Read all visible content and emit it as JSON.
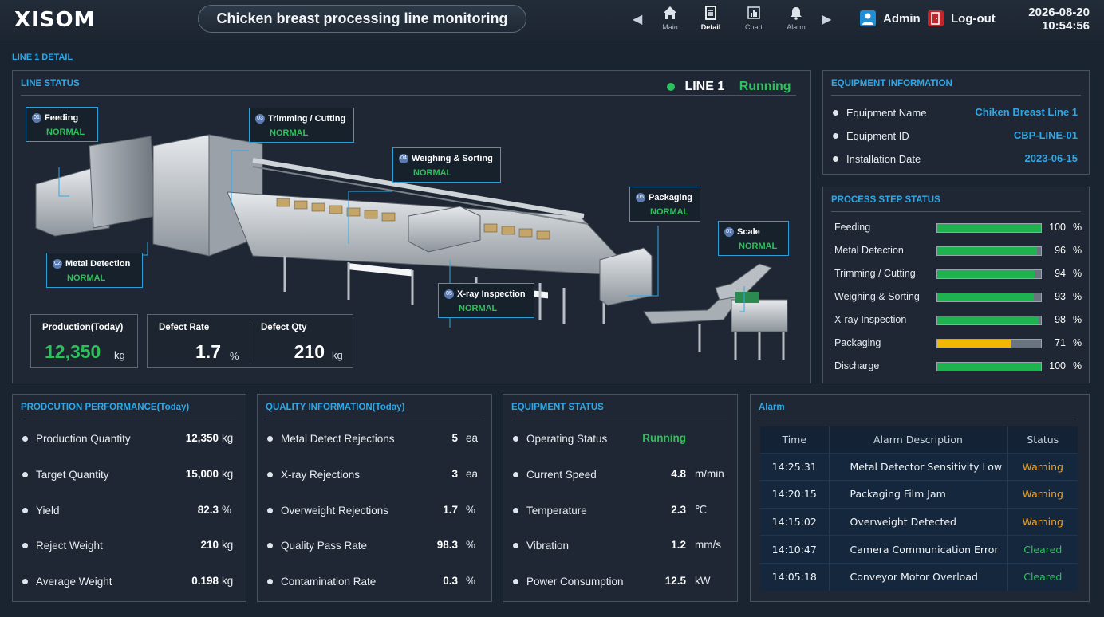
{
  "header": {
    "logo": "XISOM",
    "title": "Chicken breast processing line monitoring",
    "nav": [
      {
        "label": "Main",
        "icon": "home-icon"
      },
      {
        "label": "Detail",
        "icon": "document-icon"
      },
      {
        "label": "Chart",
        "icon": "chart-icon"
      },
      {
        "label": "Alarm",
        "icon": "bell-icon"
      }
    ],
    "user": "Admin",
    "logout": "Log-out",
    "date": "2026-08-20",
    "time": "10:54:56"
  },
  "page_label": "LINE 1 DETAIL",
  "line_status": {
    "title": "LINE STATUS",
    "line_name": "LINE 1",
    "line_state": "Running",
    "steps": [
      {
        "num": "01",
        "name": "Feeding",
        "status": "NORMAL"
      },
      {
        "num": "02",
        "name": "Metal Detection",
        "status": "NORMAL"
      },
      {
        "num": "03",
        "name": "Trimming / Cutting",
        "status": "NORMAL"
      },
      {
        "num": "04",
        "name": "Weighing & Sorting",
        "status": "NORMAL"
      },
      {
        "num": "05",
        "name": "X-ray Inspection",
        "status": "NORMAL"
      },
      {
        "num": "06",
        "name": "Packaging",
        "status": "NORMAL"
      },
      {
        "num": "07",
        "name": "Scale",
        "status": "NORMAL"
      }
    ],
    "production_label": "Production(Today)",
    "production_value": "12,350",
    "production_unit": "kg",
    "defect_rate_label": "Defect Rate",
    "defect_rate_value": "1.7",
    "defect_rate_unit": "%",
    "defect_qty_label": "Defect Qty",
    "defect_qty_value": "210",
    "defect_qty_unit": "kg"
  },
  "equipment_info": {
    "title": "EQUIPMENT INFORMATION",
    "rows": [
      {
        "label": "Equipment Name",
        "value": "Chiken Breast Line 1"
      },
      {
        "label": "Equipment ID",
        "value": "CBP-LINE-01"
      },
      {
        "label": "Installation Date",
        "value": "2023-06-15"
      }
    ]
  },
  "process_step_status": {
    "title": "PROCESS STEP STATUS",
    "unit": "%",
    "rows": [
      {
        "label": "Feeding",
        "value": 100,
        "color": "#1fb34f"
      },
      {
        "label": "Metal Detection",
        "value": 96,
        "color": "#1fb34f"
      },
      {
        "label": "Trimming / Cutting",
        "value": 94,
        "color": "#1fb34f"
      },
      {
        "label": "Weighing & Sorting",
        "value": 93,
        "color": "#1fb34f"
      },
      {
        "label": "X-ray Inspection",
        "value": 98,
        "color": "#1fb34f"
      },
      {
        "label": "Packaging",
        "value": 71,
        "color": "#f2b705"
      },
      {
        "label": "Discharge",
        "value": 100,
        "color": "#1fb34f"
      }
    ]
  },
  "production_performance": {
    "title": "PRODCUTION PERFORMANCE(Today)",
    "rows": [
      {
        "label": "Production Quantity",
        "value": "12,350",
        "unit": "kg"
      },
      {
        "label": "Target Quantity",
        "value": "15,000",
        "unit": "kg"
      },
      {
        "label": "Yield",
        "value": "82.3",
        "unit": "%"
      },
      {
        "label": "Reject Weight",
        "value": "210",
        "unit": "kg"
      },
      {
        "label": "Average Weight",
        "value": "0.198",
        "unit": "kg"
      }
    ]
  },
  "quality_info": {
    "title": "QUALITY INFORMATION(Today)",
    "rows": [
      {
        "label": "Metal Detect Rejections",
        "value": "5",
        "unit": "ea"
      },
      {
        "label": "X-ray Rejections",
        "value": "3",
        "unit": "ea"
      },
      {
        "label": "Overweight Rejections",
        "value": "1.7",
        "unit": "%"
      },
      {
        "label": "Quality Pass Rate",
        "value": "98.3",
        "unit": "%"
      },
      {
        "label": "Contamination Rate",
        "value": "0.3",
        "unit": "%"
      }
    ]
  },
  "equipment_status": {
    "title": "EQUIPMENT STATUS",
    "rows": [
      {
        "label": "Operating Status",
        "value": "Running",
        "unit": ""
      },
      {
        "label": "Current Speed",
        "value": "4.8",
        "unit": "m/min"
      },
      {
        "label": "Temperature",
        "value": "2.3",
        "unit": "℃"
      },
      {
        "label": "Vibration",
        "value": "1.2",
        "unit": "mm/s"
      },
      {
        "label": "Power Consumption",
        "value": "12.5",
        "unit": "kW"
      }
    ]
  },
  "alarm": {
    "title": "Alarm",
    "headers": [
      "Time",
      "Alarm Description",
      "Status"
    ],
    "rows": [
      {
        "time": "14:25:31",
        "desc": "Metal Detector Sensitivity Low",
        "status": "Warning"
      },
      {
        "time": "14:20:15",
        "desc": "Packaging Film Jam",
        "status": "Warning"
      },
      {
        "time": "14:15:02",
        "desc": "Overweight Detected",
        "status": "Warning"
      },
      {
        "time": "14:10:47",
        "desc": "Camera Communication Error",
        "status": "Cleared"
      },
      {
        "time": "14:05:18",
        "desc": "Conveyor Motor Overload",
        "status": "Cleared"
      }
    ]
  },
  "colors": {
    "accent": "#2fa8e8",
    "ok": "#2ec05a",
    "warning": "#f0a020",
    "cleared": "#2ec05a"
  }
}
